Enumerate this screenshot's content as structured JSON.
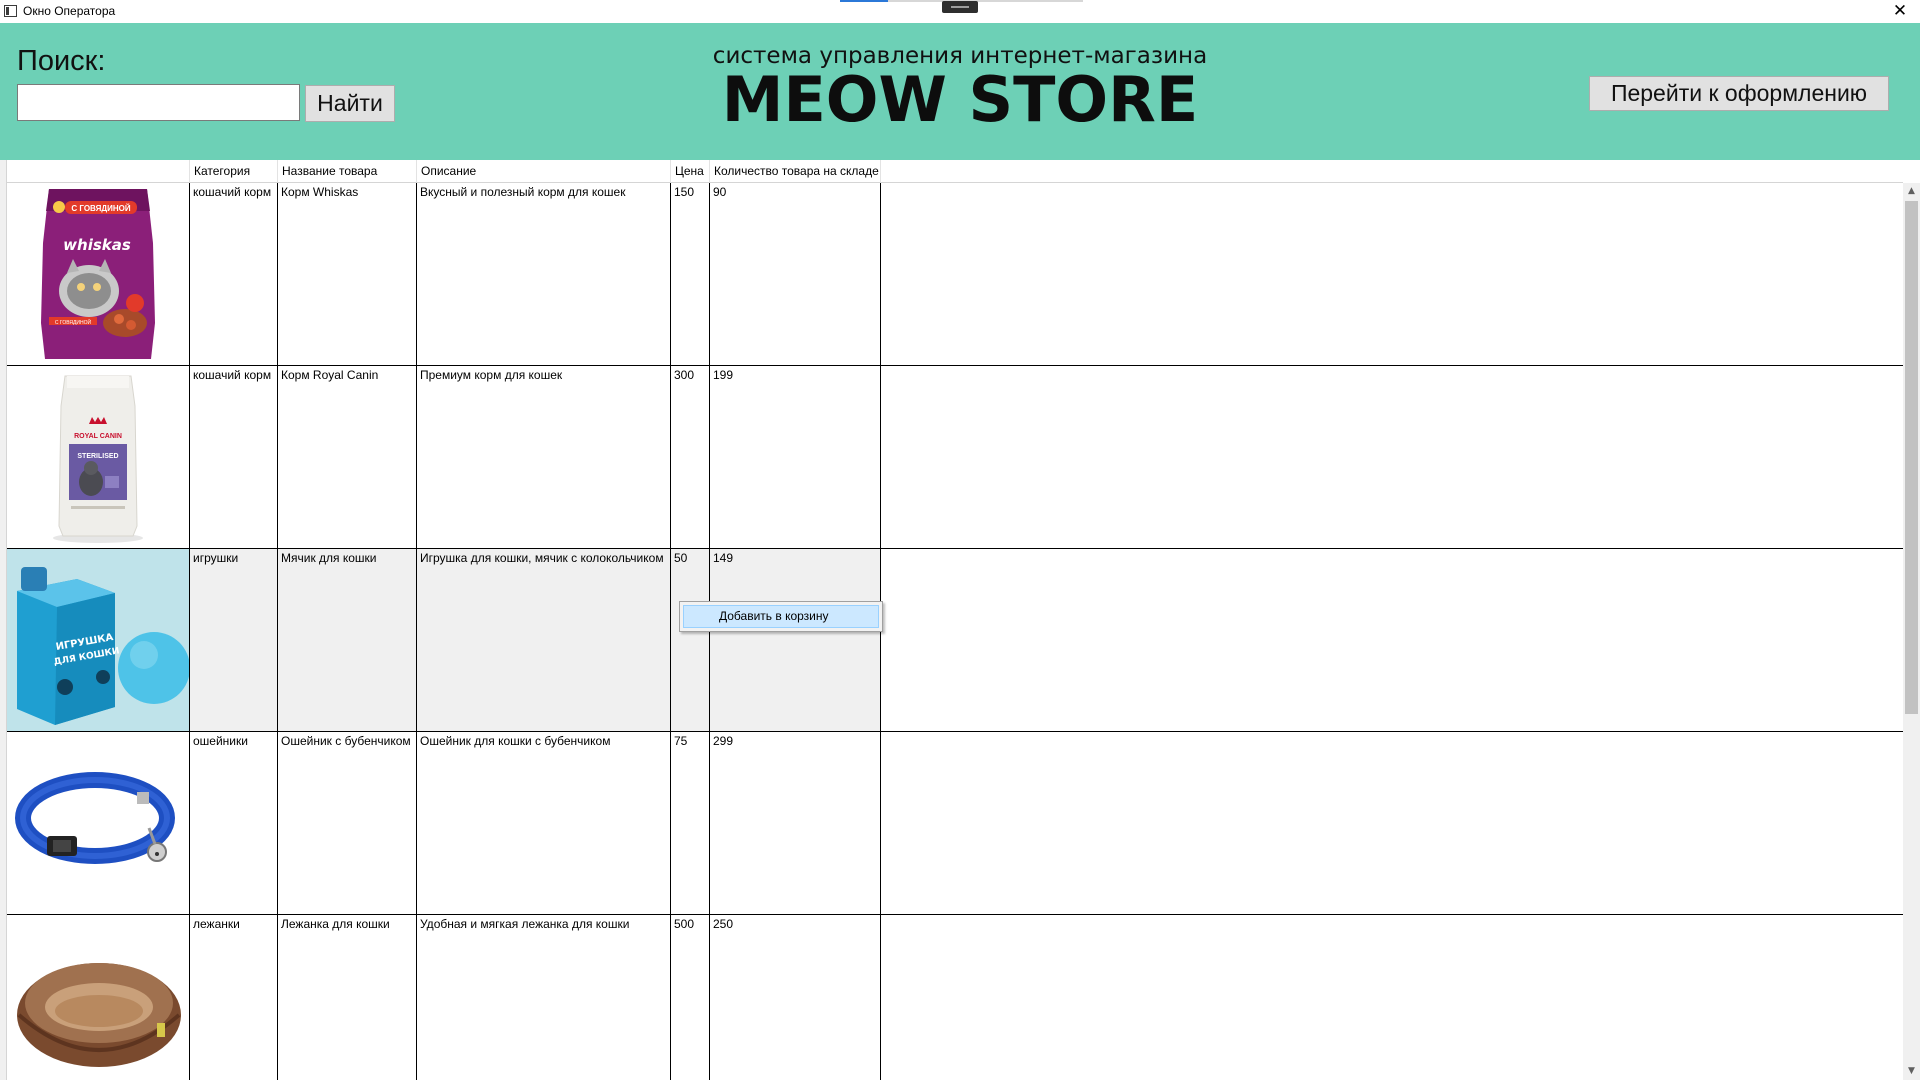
{
  "window": {
    "title": "Окно Оператора",
    "close_glyph": "✕"
  },
  "header": {
    "search_label": "Поиск:",
    "search_value": "",
    "search_button": "Найти",
    "subtitle": "система управления интернет-магазина",
    "brand": "MEOW STORE",
    "checkout_button": "Перейти к оформлению",
    "background_color": "#6dd0b6"
  },
  "table": {
    "columns": [
      "Категория",
      "Название товара",
      "Описание",
      "Цена",
      "Количество товара на складе"
    ],
    "rows": [
      {
        "category": "кошачий корм",
        "name": "Корм Whiskas",
        "description": "Вкусный и полезный корм для кошек",
        "price": "150",
        "stock": "90",
        "image_icon": "whiskas-pack-image"
      },
      {
        "category": "кошачий корм",
        "name": "Корм Royal Canin",
        "description": "Премиум корм для кошек",
        "price": "300",
        "stock": "199",
        "image_icon": "royal-canin-pack-image"
      },
      {
        "category": "игрушки",
        "name": "Мячик для кошки",
        "description": "Игрушка для кошки, мячик с колокольчиком",
        "price": "50",
        "stock": "149",
        "image_icon": "toy-ball-image"
      },
      {
        "category": "ошейники",
        "name": "Ошейник с бубенчиком",
        "description": "Ошейник для кошки с бубенчиком",
        "price": "75",
        "stock": "299",
        "image_icon": "collar-image"
      },
      {
        "category": "лежанки",
        "name": "Лежанка для кошки",
        "description": "Удобная и мягкая лежанка для кошки",
        "price": "500",
        "stock": "250",
        "image_icon": "cat-bed-image"
      }
    ],
    "selected_row": 2
  },
  "context_menu": {
    "item": "Добавить в корзину"
  },
  "whiskas_text": {
    "badge": "С ГОВЯДИНОЙ",
    "brand": "whiskas",
    "strip": "С ГОВЯДИНОЙ"
  },
  "royal_text": {
    "brand": "ROYAL CANIN",
    "line": "STERILISED"
  },
  "toy_text": {
    "line1": "ИГРУШКА",
    "line2": "ДЛЯ КОШКИ"
  }
}
